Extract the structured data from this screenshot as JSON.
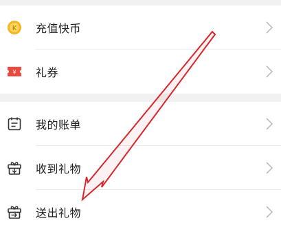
{
  "menu": {
    "items": [
      {
        "label": "充值快币",
        "icon": "coin-icon"
      },
      {
        "label": "礼券",
        "icon": "ticket-icon"
      },
      {
        "label": "我的账单",
        "icon": "calendar-icon"
      },
      {
        "label": "收到礼物",
        "icon": "gift-received-icon"
      },
      {
        "label": "送出礼物",
        "icon": "gift-sent-icon"
      }
    ]
  },
  "colors": {
    "coin": "#f5b520",
    "ticket": "#e94a3f",
    "icon_line": "#333333",
    "chevron": "#bdbdbd",
    "section_gap": "#f1f1f1",
    "annotation_arrow": "#d8262c"
  }
}
